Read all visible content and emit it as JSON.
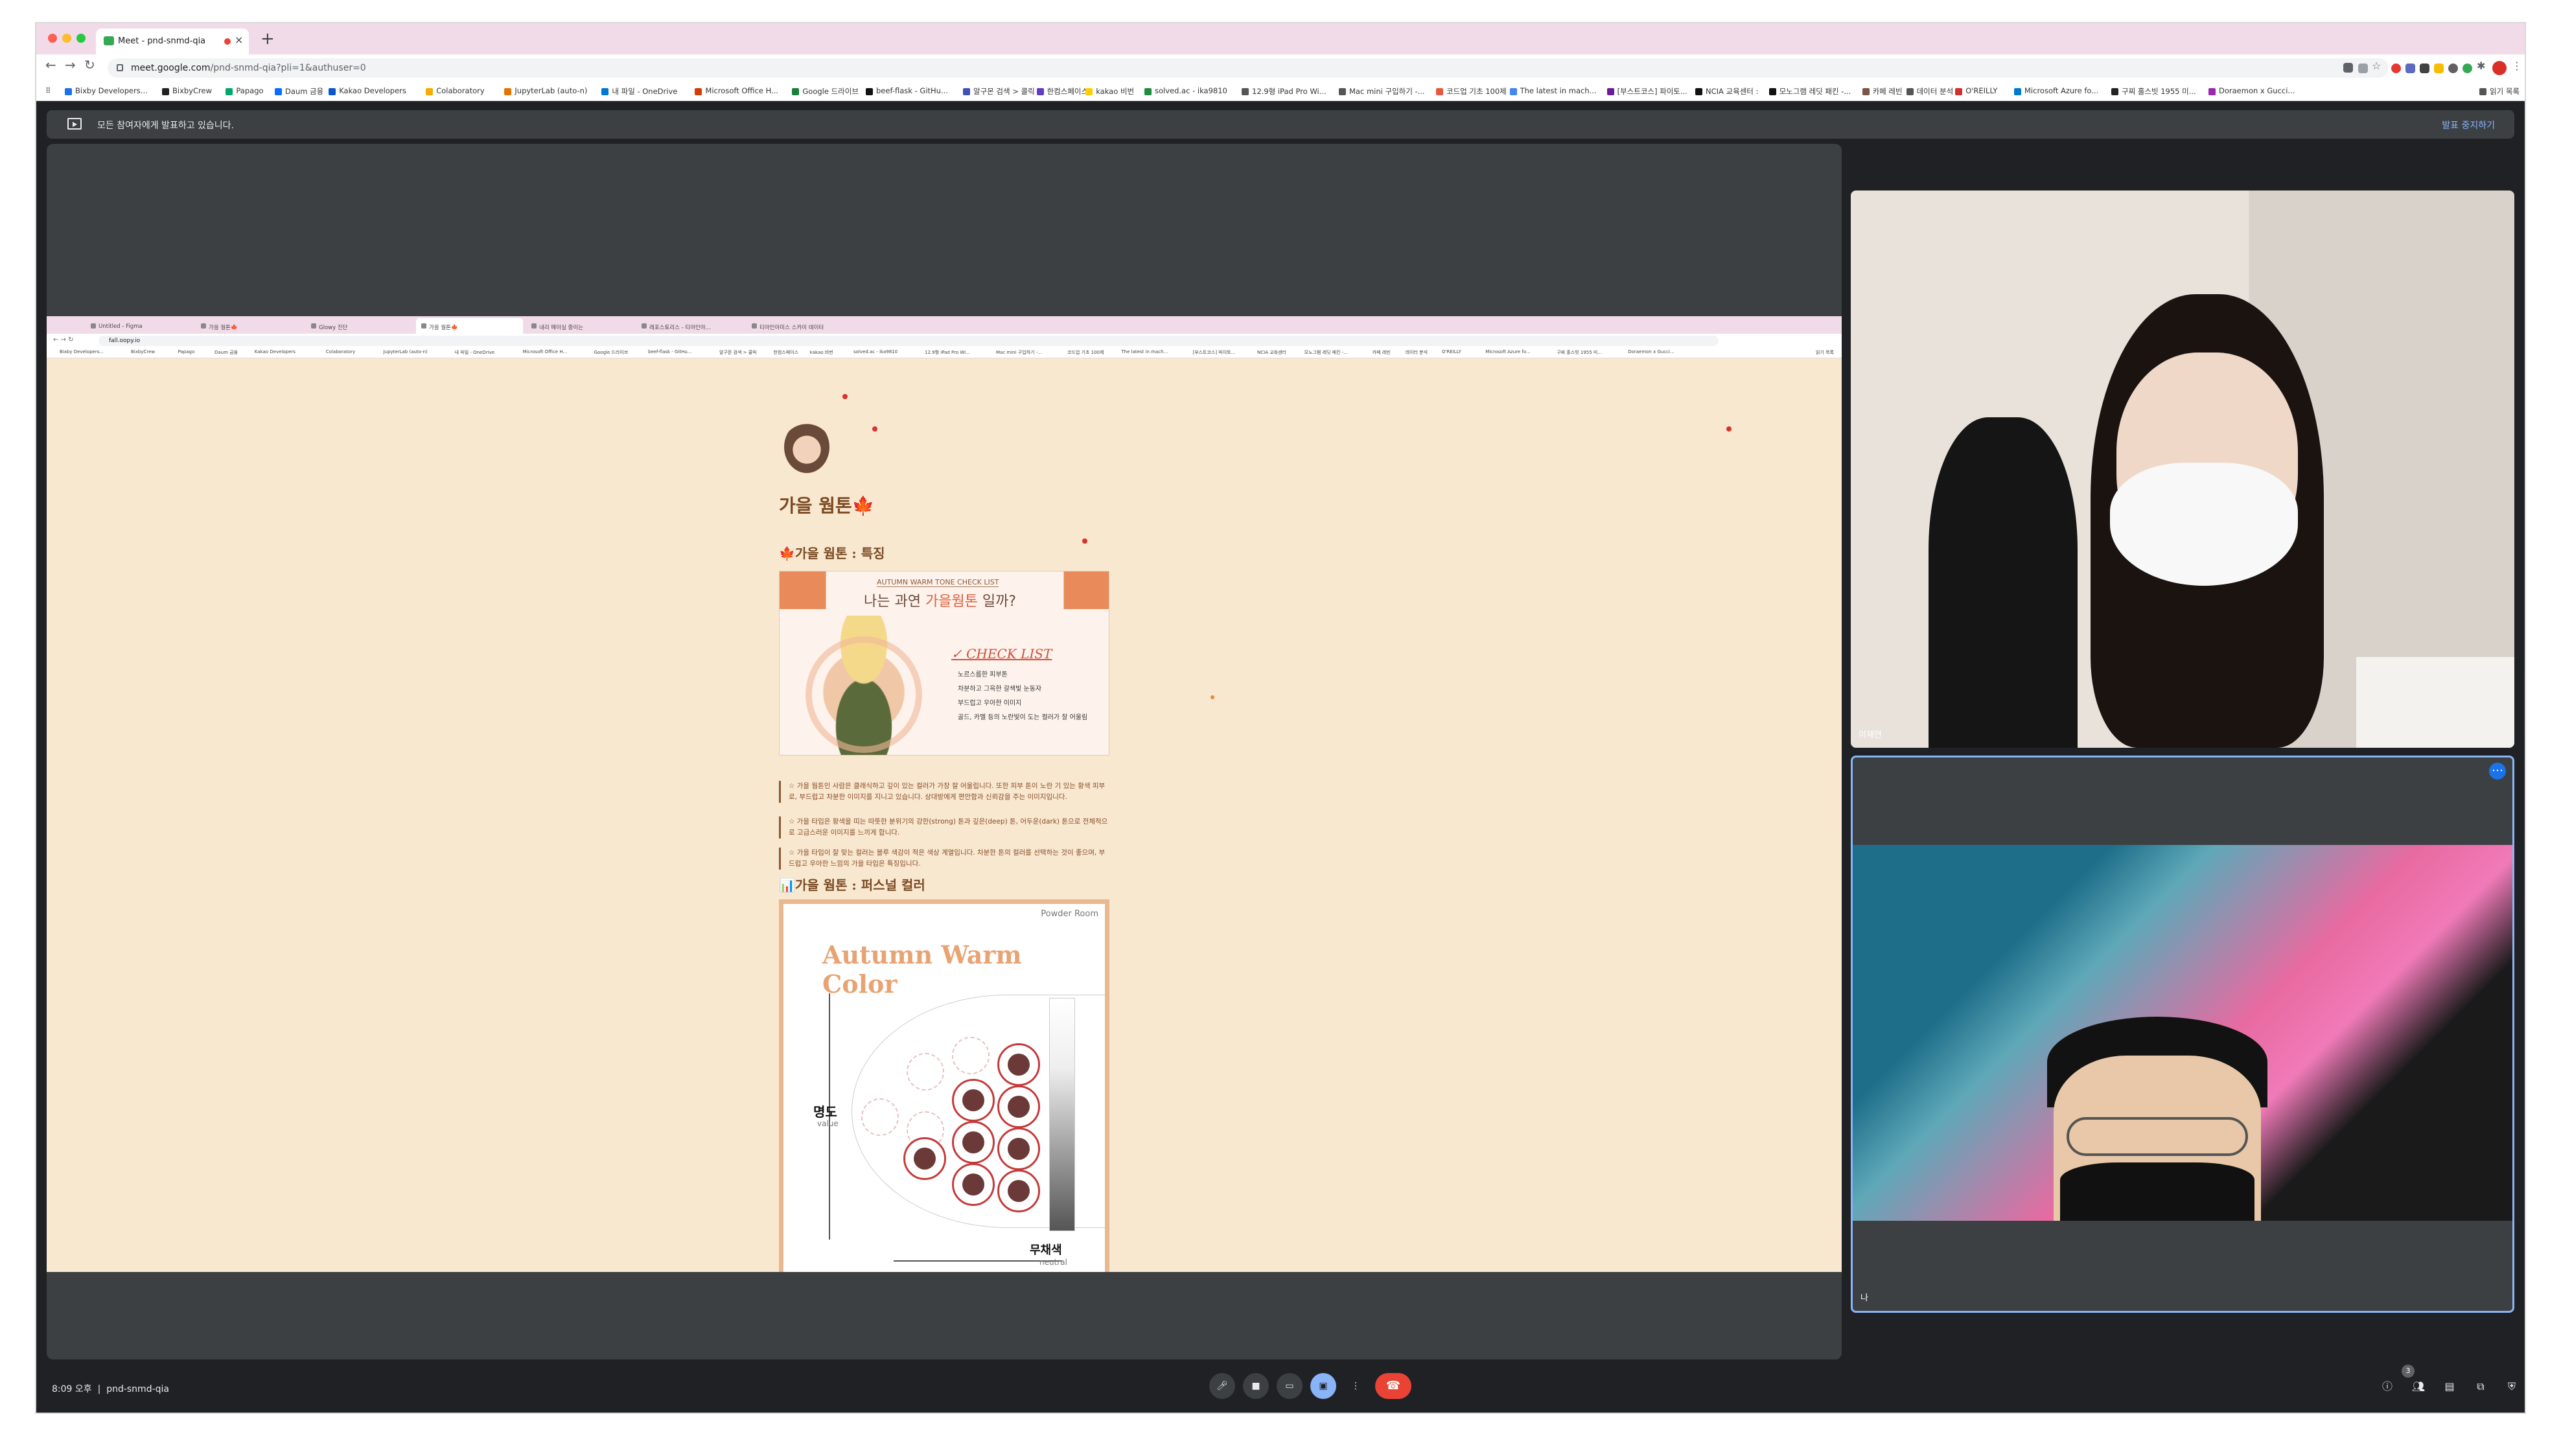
{
  "browser": {
    "tab_title": "Meet - pnd-snmd-qia",
    "url_host": "meet.google.com",
    "url_path": "/pnd-snmd-qia?pli=1&authuser=0",
    "bookmarks": [
      "Bixby Developers...",
      "BixbyCrew",
      "Papago",
      "Daum 금융",
      "Kakao Developers",
      "Colaboratory",
      "JupyterLab (auto-n)",
      "내 파일 - OneDrive",
      "Microsoft Office H...",
      "Google 드라이브",
      "beef-flask - GitHu...",
      "알구몬 검색 > 콜릭",
      "한컴스페이스",
      "kakao 비번",
      "solved.ac - ika9810",
      "12.9형 iPad Pro Wi...",
      "Mac mini 구입하기 -...",
      "코드업 기초 100제",
      "The latest in mach...",
      "[부스트코스] 파이토...",
      "NCIA 교육센터 :",
      "모노그램 레딧 패킨 -...",
      "카페 레빈",
      "데이터 분석",
      "O'REILLY",
      "Microsoft Azure fo...",
      "구찌 홀스빗 1955 미...",
      "Doraemon x Gucci...",
      "읽기 목록"
    ]
  },
  "meet": {
    "present_banner": "모든 참여자에게 발표하고 있습니다.",
    "stop_presenting": "발표 중지하기",
    "participant1_name": "이재연",
    "participant2_name": "나",
    "time": "8:09 오후",
    "separator": "|",
    "meeting_code": "pnd-snmd-qia",
    "participants_count": "3"
  },
  "shared": {
    "tabs": [
      "Untitled - Figma",
      "가을 웜톤🍁",
      "Glowy 진단",
      "가을 웜톤🍁",
      "내리 메이실 중이는",
      "레포스토리스 - 티아인아...",
      "티아인아미스 스카이 데이터"
    ],
    "url": "fall.oopy.io",
    "inner_bookmarks": [
      "Bixby Developers...",
      "BixbyCrew",
      "Papago",
      "Daum 금융",
      "Kakao Developers",
      "Colaboratory",
      "JupyterLab (auto-n)",
      "내 파일 - OneDrive",
      "Microsoft Office H...",
      "Google 드라이브",
      "beef-flask - GitHu...",
      "알구몬 검색 > 콜릭",
      "한컴스페이스",
      "kakao 비번",
      "solved.ac - ika9810",
      "12.9형 iPad Pro Wi...",
      "Mac mini 구입하기 -...",
      "코드업 기초 100제",
      "The latest in mach...",
      "[부스트코스] 파이토...",
      "NCIA 교육센터",
      "모노그램 레딧 패킨 -...",
      "카페 레빈",
      "데이터 분석",
      "O'REILLY",
      "Microsoft Azure fo...",
      "구찌 홀스빗 1955 미...",
      "Doraemon x Gucci...",
      "읽기 목록"
    ],
    "page_title": "가을 웜톤🍁",
    "section1": "🍁가을 웜톤 : 특징",
    "card_kicker": "AUTUMN WARM TONE CHECK LIST",
    "card_big_a": "나는 과연 ",
    "card_big_b": "가을웜톤",
    "card_big_c": " 일까?",
    "check_list": "CHECK LIST",
    "check_items": [
      "노르스름한 피부톤",
      "차분하고 그윽한 갈색빛 눈동자",
      "부드럽고 우아한 이미지",
      "골드, 카멜 등의 노란빛이 도는 컬러가 잘 어울림"
    ],
    "notes": [
      "☆ 가을 웜톤인 사람은 클래식하고 깊이 있는 컬러가 가장 잘 어울립니다. 또한 피부 톤이 노란 기 있는 황색 피부로, 부드럽고 차분한 이미지를 지니고 있습니다. 상대방에게 편안함과 신뢰감을 주는 이미지입니다.",
      "☆ 가을 타입은 황색을 띠는 따뜻한 분위기의 강한(strong) 톤과 깊은(deep) 톤, 어두운(dark) 톤으로 전체적으로 고급스러운 이미지를 느끼게 합니다.",
      "☆ 가을 타입이 잘 맞는 컬러는 블루 색감이 적은 색상 계열입니다. 차분한 톤의 컬러를 선택하는 것이 좋으며, 부드럽고 우아한 느낌의 가을 타입은 특징입니다."
    ],
    "section2": "📊가을 웜톤 : 퍼스널 컬러",
    "powder_room": "Powder Room",
    "chart_title": "Autumn Warm Color",
    "y_axis": "명도",
    "y_axis_sub": "value",
    "x_axis": "무채색",
    "x_axis_sub": "neutral"
  }
}
